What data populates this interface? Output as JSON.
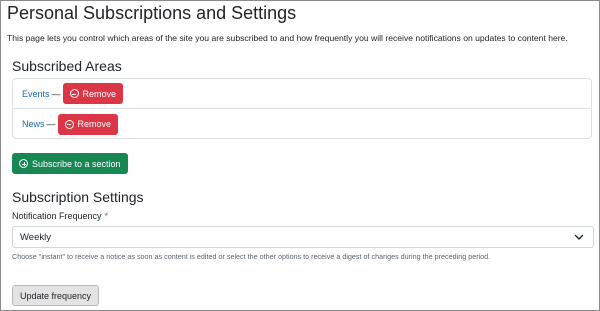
{
  "page": {
    "title": "Personal Subscriptions and Settings",
    "intro": "This page lets you control which areas of the site you are subscribed to and how frequently you will receive notifications on updates to content here."
  },
  "subscribed_areas": {
    "heading": "Subscribed Areas",
    "separator": "—",
    "remove_label": "Remove",
    "items": [
      {
        "label": "Events"
      },
      {
        "label": "News"
      }
    ],
    "subscribe_button": "Subscribe to a section"
  },
  "settings": {
    "heading": "Subscription Settings",
    "frequency_label": "Notification Frequency",
    "required_mark": "*",
    "frequency_value": "Weekly",
    "help_text": "Choose \"instant\" to receive a notice as soon as content is edited or select the other options to receive a digest of changes during the preceding period.",
    "update_button": "Update frequency"
  },
  "colors": {
    "danger": "#dc3545",
    "success": "#198754",
    "link": "#1a6bb5"
  },
  "icons": {
    "remove": "minus-circle-icon",
    "subscribe": "plus-circle-icon",
    "select": "chevron-down-icon"
  }
}
